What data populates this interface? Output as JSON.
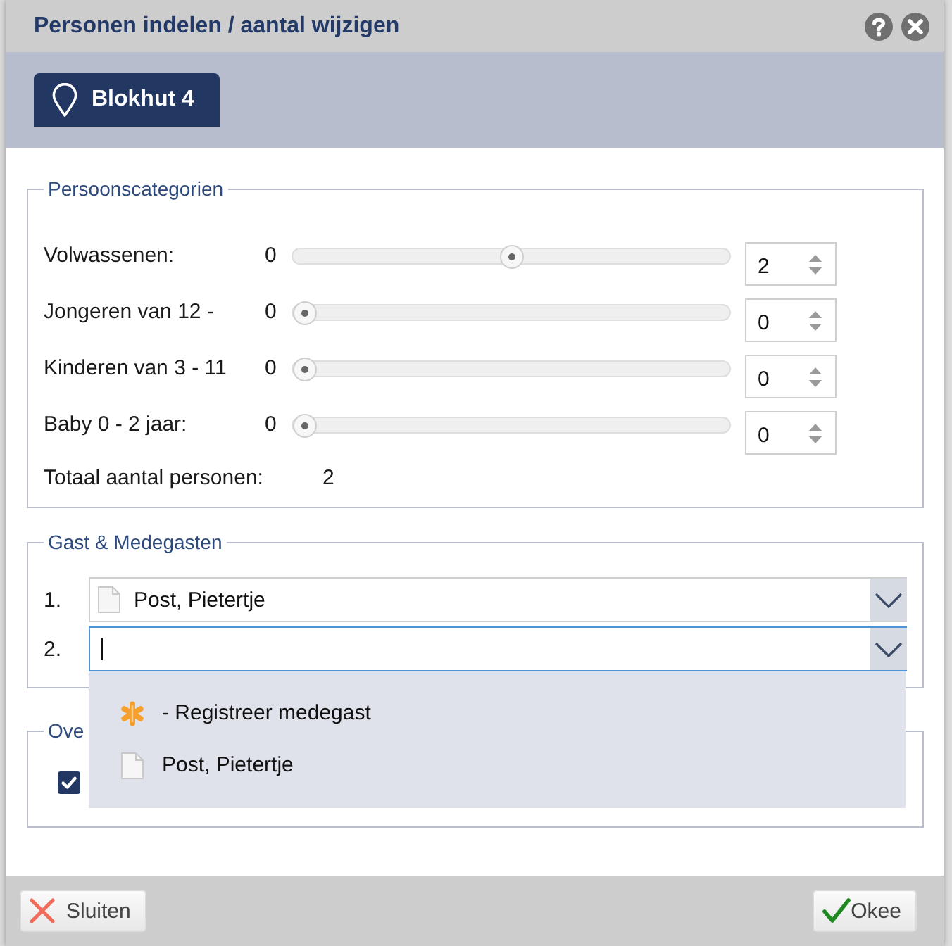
{
  "window": {
    "title": "Personen indelen / aantal wijzigen"
  },
  "tabs": [
    {
      "label": "Blokhut 4",
      "selected": true
    }
  ],
  "categories": {
    "legend": "Persoonscategorien",
    "rows": [
      {
        "label": "Volwassenen:",
        "min": "0",
        "level": 0.5,
        "value": "2"
      },
      {
        "label": "Jongeren van 12 -",
        "min": "0",
        "level": 0,
        "value": "0"
      },
      {
        "label": "Kinderen van 3 - 11",
        "min": "0",
        "level": 0,
        "value": "0"
      },
      {
        "label": "Baby 0 - 2 jaar:",
        "min": "0",
        "level": 0,
        "value": "0"
      }
    ],
    "total_label": "Totaal aantal personen:",
    "total": "2"
  },
  "guests": {
    "legend": "Gast & Medegasten",
    "rows": [
      {
        "number": "1.",
        "value": "Post, Pietertje",
        "focused": false
      },
      {
        "number": "2.",
        "focused": true
      }
    ],
    "dropdown": {
      "items": [
        {
          "kind": "register",
          "label": "- Registreer medegast"
        },
        {
          "kind": "guest",
          "label": "Post, Pietertje"
        }
      ]
    }
  },
  "other": {
    "legend": "Ove",
    "checkbox": {
      "checked": true
    }
  },
  "buttons": [
    {
      "kind": "close",
      "label": "Sluiten"
    },
    {
      "kind": "ok",
      "label": "Okee"
    }
  ]
}
